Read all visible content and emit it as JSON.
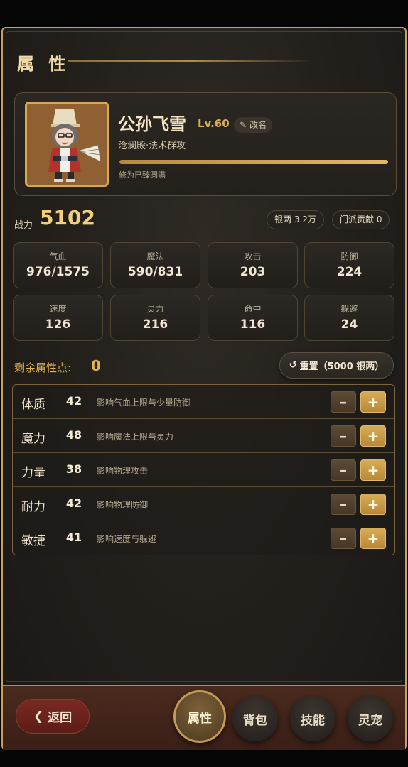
{
  "page": {
    "title": "属 性"
  },
  "profile": {
    "name": "公孙飞雪",
    "level": "Lv.60",
    "rename_label": "改名",
    "sect": "沧澜殿·法术群攻",
    "cultivation_text": "修为已臻圆满",
    "cultivation_progress": 1.0
  },
  "power": {
    "label": "战力",
    "value": "5102"
  },
  "currency": {
    "silver": "银两 3.2万",
    "contribution": "门派贡献 0"
  },
  "stats": [
    {
      "label": "气血",
      "value": "976/1575"
    },
    {
      "label": "魔法",
      "value": "590/831"
    },
    {
      "label": "攻击",
      "value": "203"
    },
    {
      "label": "防御",
      "value": "224"
    },
    {
      "label": "速度",
      "value": "126"
    },
    {
      "label": "灵力",
      "value": "216"
    },
    {
      "label": "命中",
      "value": "116"
    },
    {
      "label": "躲避",
      "value": "24"
    }
  ],
  "remaining": {
    "label": "剩余属性点:",
    "value": "0"
  },
  "reset": {
    "label": "重置（5000 银两）"
  },
  "attributes": [
    {
      "name": "体质",
      "value": "42",
      "desc": "影响气血上限与少量防御",
      "minus": "–",
      "plus": "+"
    },
    {
      "name": "魔力",
      "value": "48",
      "desc": "影响魔法上限与灵力",
      "minus": "–",
      "plus": "+"
    },
    {
      "name": "力量",
      "value": "38",
      "desc": "影响物理攻击",
      "minus": "–",
      "plus": "+"
    },
    {
      "name": "耐力",
      "value": "42",
      "desc": "影响物理防御",
      "minus": "–",
      "plus": "+"
    },
    {
      "name": "敏捷",
      "value": "41",
      "desc": "影响速度与躲避",
      "minus": "–",
      "plus": "+"
    }
  ],
  "nav": {
    "back": "返回",
    "tabs": [
      {
        "label": "属性",
        "active": true
      },
      {
        "label": "背包",
        "active": false
      },
      {
        "label": "技能",
        "active": false
      },
      {
        "label": "灵宠",
        "active": false
      }
    ]
  },
  "icons": {
    "rename": "pencil-icon",
    "reset": "refresh-icon",
    "back": "chevron-left-icon"
  }
}
